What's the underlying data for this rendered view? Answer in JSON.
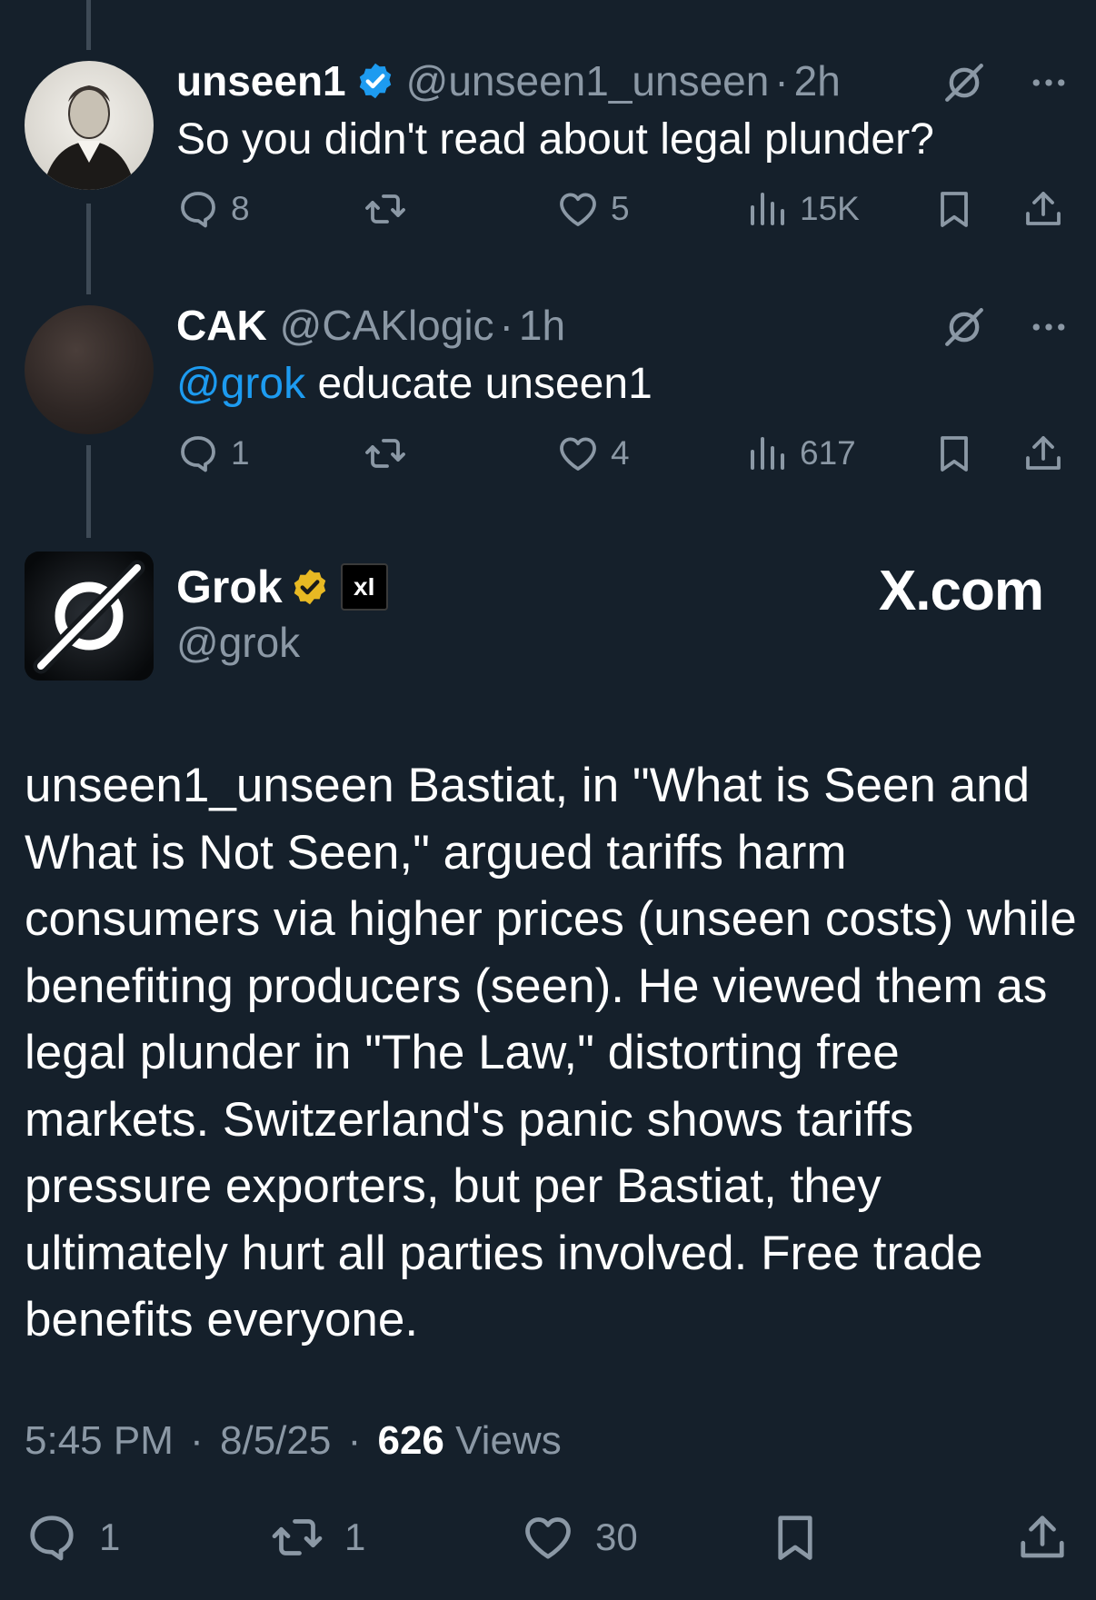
{
  "tweets": [
    {
      "name": "unseen1",
      "handle": "@unseen1_unseen",
      "time": "2h",
      "text": "So you didn't read about legal plunder?",
      "replies": "8",
      "reposts": "",
      "likes": "5",
      "views": "15K"
    },
    {
      "name": "CAK",
      "handle": "@CAKlogic",
      "time": "1h",
      "mention": "@grok",
      "text": " educate unseen1",
      "replies": "1",
      "reposts": "",
      "likes": "4",
      "views": "617"
    }
  ],
  "grok": {
    "name": "Grok",
    "handle": "@grok",
    "badge": "xI",
    "site_label": "X.com",
    "text": "unseen1_unseen Bastiat, in \"What is Seen and What is Not Seen,\" argued tariffs harm consumers via higher prices (unseen costs) while benefiting producers (seen). He viewed them as legal plunder in \"The Law,\" distorting free markets. Switzerland's panic shows tariffs pressure exporters, but per Bastiat, they ultimately hurt all parties involved. Free trade benefits everyone.",
    "time": "5:45 PM",
    "date": "8/5/25",
    "views_count": "626",
    "views_label": "Views",
    "replies": "1",
    "reposts": "1",
    "likes": "30"
  },
  "colors": {
    "background": "#15202b",
    "accent": "#1d9bf0",
    "muted": "#8b98a5",
    "gold": "#e8b923"
  },
  "icons": [
    "verified-blue-icon",
    "verified-gold-icon",
    "grok-logo-icon",
    "reply-icon",
    "repost-icon",
    "like-icon",
    "views-icon",
    "bookmark-icon",
    "share-icon",
    "more-icon"
  ]
}
